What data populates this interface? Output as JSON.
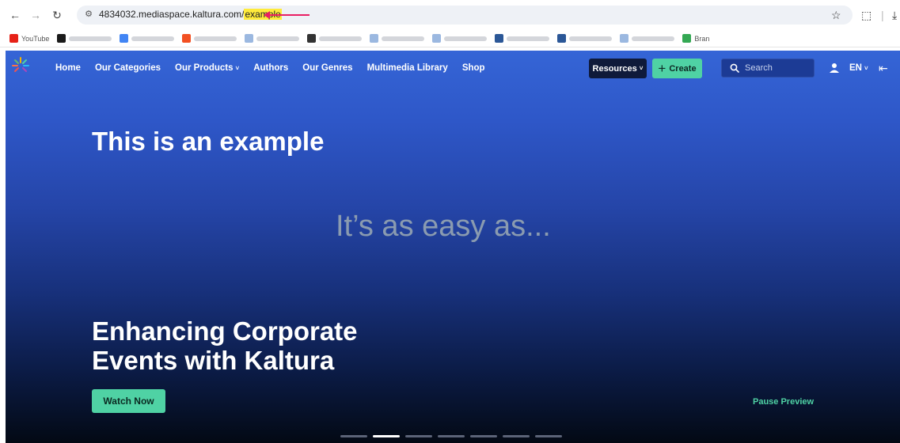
{
  "browser": {
    "url_prefix": "4834032.mediaspace.kaltura.com/",
    "url_highlight": "example",
    "back_icon": "arrow-left-icon",
    "forward_icon": "arrow-right-icon",
    "reload_icon": "reload-icon",
    "bookmarks": [
      {
        "label": "YouTube",
        "color": "#e62117"
      },
      {
        "label": "",
        "color": "#1a1a1a"
      },
      {
        "label": "",
        "color": "#4285f4"
      },
      {
        "label": "",
        "color": "#f25022"
      },
      {
        "label": "",
        "color": "#9bb8e0"
      },
      {
        "label": "",
        "color": "#333333"
      },
      {
        "label": "",
        "color": "#9bb8e0"
      },
      {
        "label": "",
        "color": "#9bb8e0"
      },
      {
        "label": "",
        "color": "#2b5797"
      },
      {
        "label": "",
        "color": "#2b5797"
      },
      {
        "label": "",
        "color": "#9bb8e0"
      },
      {
        "label": "Bran",
        "color": "#34a853"
      }
    ]
  },
  "nav": {
    "items": [
      {
        "label": "Home"
      },
      {
        "label": "Our Categories"
      },
      {
        "label": "Our Products",
        "dropdown": "˅"
      },
      {
        "label": "Authors"
      },
      {
        "label": "Our Genres"
      },
      {
        "label": "Multimedia Library"
      },
      {
        "label": "Shop"
      }
    ],
    "resources_label": "Resources",
    "create_label": "Create",
    "search_placeholder": "Search",
    "lang_label": "EN",
    "chevron": "˅",
    "plus": "+",
    "exit": "⇤"
  },
  "hero": {
    "title": "This is an example",
    "subtitle": "It’s as easy as...",
    "event_title_line1": "Enhancing Corporate",
    "event_title_line2": "Events with Kaltura",
    "watch_label": "Watch Now",
    "pause_label": "Pause Preview",
    "slides": 7,
    "active_slide": 2
  },
  "colors": {
    "accent": "#4fd2a4",
    "highlight": "#ffeb3b",
    "arrow": "#e91e63",
    "nav_dark": "#0f1a3a"
  }
}
